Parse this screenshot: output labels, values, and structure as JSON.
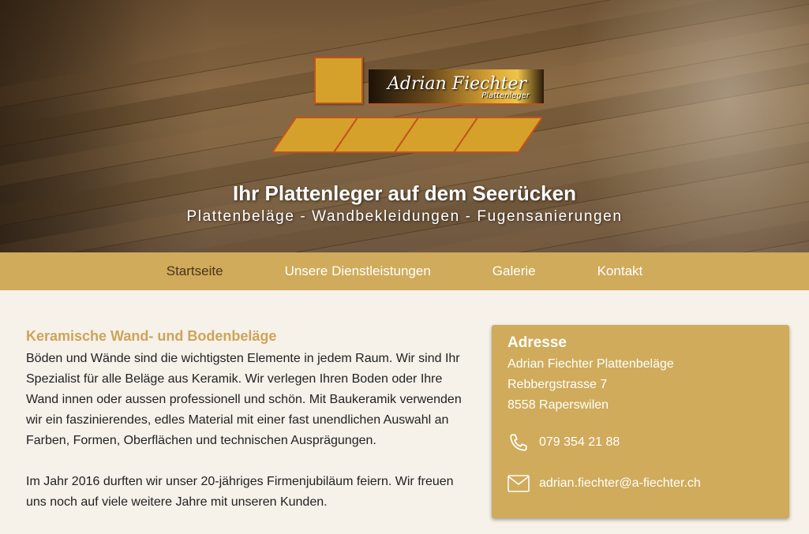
{
  "hero": {
    "logo_name": "Adrian Fiechter",
    "logo_sub": "Plattenleger",
    "title": "Ihr Plattenleger auf dem Seerücken",
    "subtitle": "Plattenbeläge - Wandbekleidungen - Fugensanierungen"
  },
  "nav": {
    "items": [
      {
        "label": "Startseite",
        "active": true
      },
      {
        "label": "Unsere Dienstleistungen",
        "active": false
      },
      {
        "label": "Galerie",
        "active": false
      },
      {
        "label": "Kontakt",
        "active": false
      }
    ]
  },
  "content": {
    "heading": "Keramische Wand- und Bodenbeläge",
    "paragraphs": [
      "Böden und Wände sind die wichtigsten Elemente in jedem Raum. Wir sind Ihr Spezialist für alle Beläge aus Keramik. Wir verlegen Ihren Boden oder Ihre Wand innen oder aussen professionell und schön. Mit Baukeramik verwenden wir ein faszinierendes, edles Material mit einer fast unendlichen Auswahl an Farben, Formen, Oberflächen und technischen Ausprägungen.",
      "Im Jahr 2016 durften wir unser 20-jähriges Firmenjubiläum feiern. Wir freuen uns noch auf viele weitere Jahre mit unseren Kunden."
    ]
  },
  "address": {
    "heading": "Adresse",
    "lines": [
      "Adrian Fiechter Plattenbeläge",
      "Rebbergstrasse 7",
      "8558 Raperswilen"
    ],
    "phone": "079 354 21 88",
    "email": "adrian.fiechter@a-fiechter.ch",
    "icons": {
      "phone": "phone-icon",
      "email": "envelope-icon"
    }
  },
  "colors": {
    "accent": "#cfab5b",
    "heading": "#cda45a",
    "nav_active": "#4a341a",
    "background": "#f6f1e9",
    "logo_tile": "#d6a12a",
    "logo_border": "#c0531b"
  }
}
